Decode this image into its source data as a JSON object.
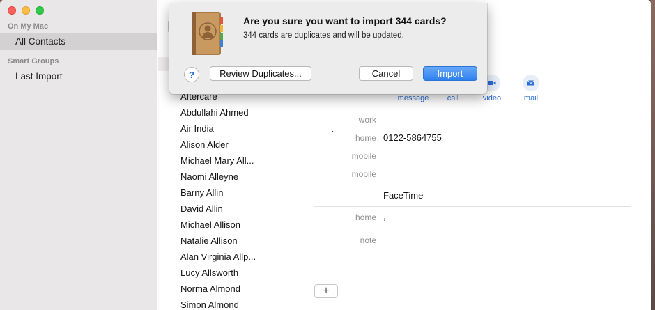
{
  "sidebar": {
    "section_mac": "On My Mac",
    "all_contacts": "All Contacts",
    "section_smart": "Smart Groups",
    "last_import": "Last Import"
  },
  "contacts": [
    "Aftercare",
    "Abdullahi Ahmed",
    "Air India",
    "Alison Alder",
    "Michael Mary All...",
    "Naomi Alleyne",
    "Barny Allin",
    "David Allin",
    "Michael Allison",
    "Natalie Allison",
    "Alan Virginia Allp...",
    "Lucy Allsworth",
    "Norma Almond",
    "Simon Almond"
  ],
  "actions": [
    {
      "label": "message",
      "icon": "message-icon"
    },
    {
      "label": "call",
      "icon": "phone-icon"
    },
    {
      "label": "video",
      "icon": "video-icon"
    },
    {
      "label": "mail",
      "icon": "mail-icon"
    }
  ],
  "fields": {
    "work_label": "work",
    "home_label": "home",
    "home_value": "0122-5864755",
    "mobile1_label": "mobile",
    "mobile2_label": "mobile",
    "facetime_value": "FaceTime",
    "home_addr_label": "home",
    "home_addr_value": ",",
    "note_label": "note"
  },
  "add_button": "+",
  "dialog": {
    "title": "Are you sure you want to import 344 cards?",
    "message": "344 cards are duplicates and will be updated.",
    "help": "?",
    "review": "Review Duplicates...",
    "cancel": "Cancel",
    "import": "Import"
  },
  "colors": {
    "accent": "#2f80ef",
    "sidebar_bg": "#e9e7e8",
    "selection": "#d3d1d2",
    "link": "#2a6cd6"
  }
}
